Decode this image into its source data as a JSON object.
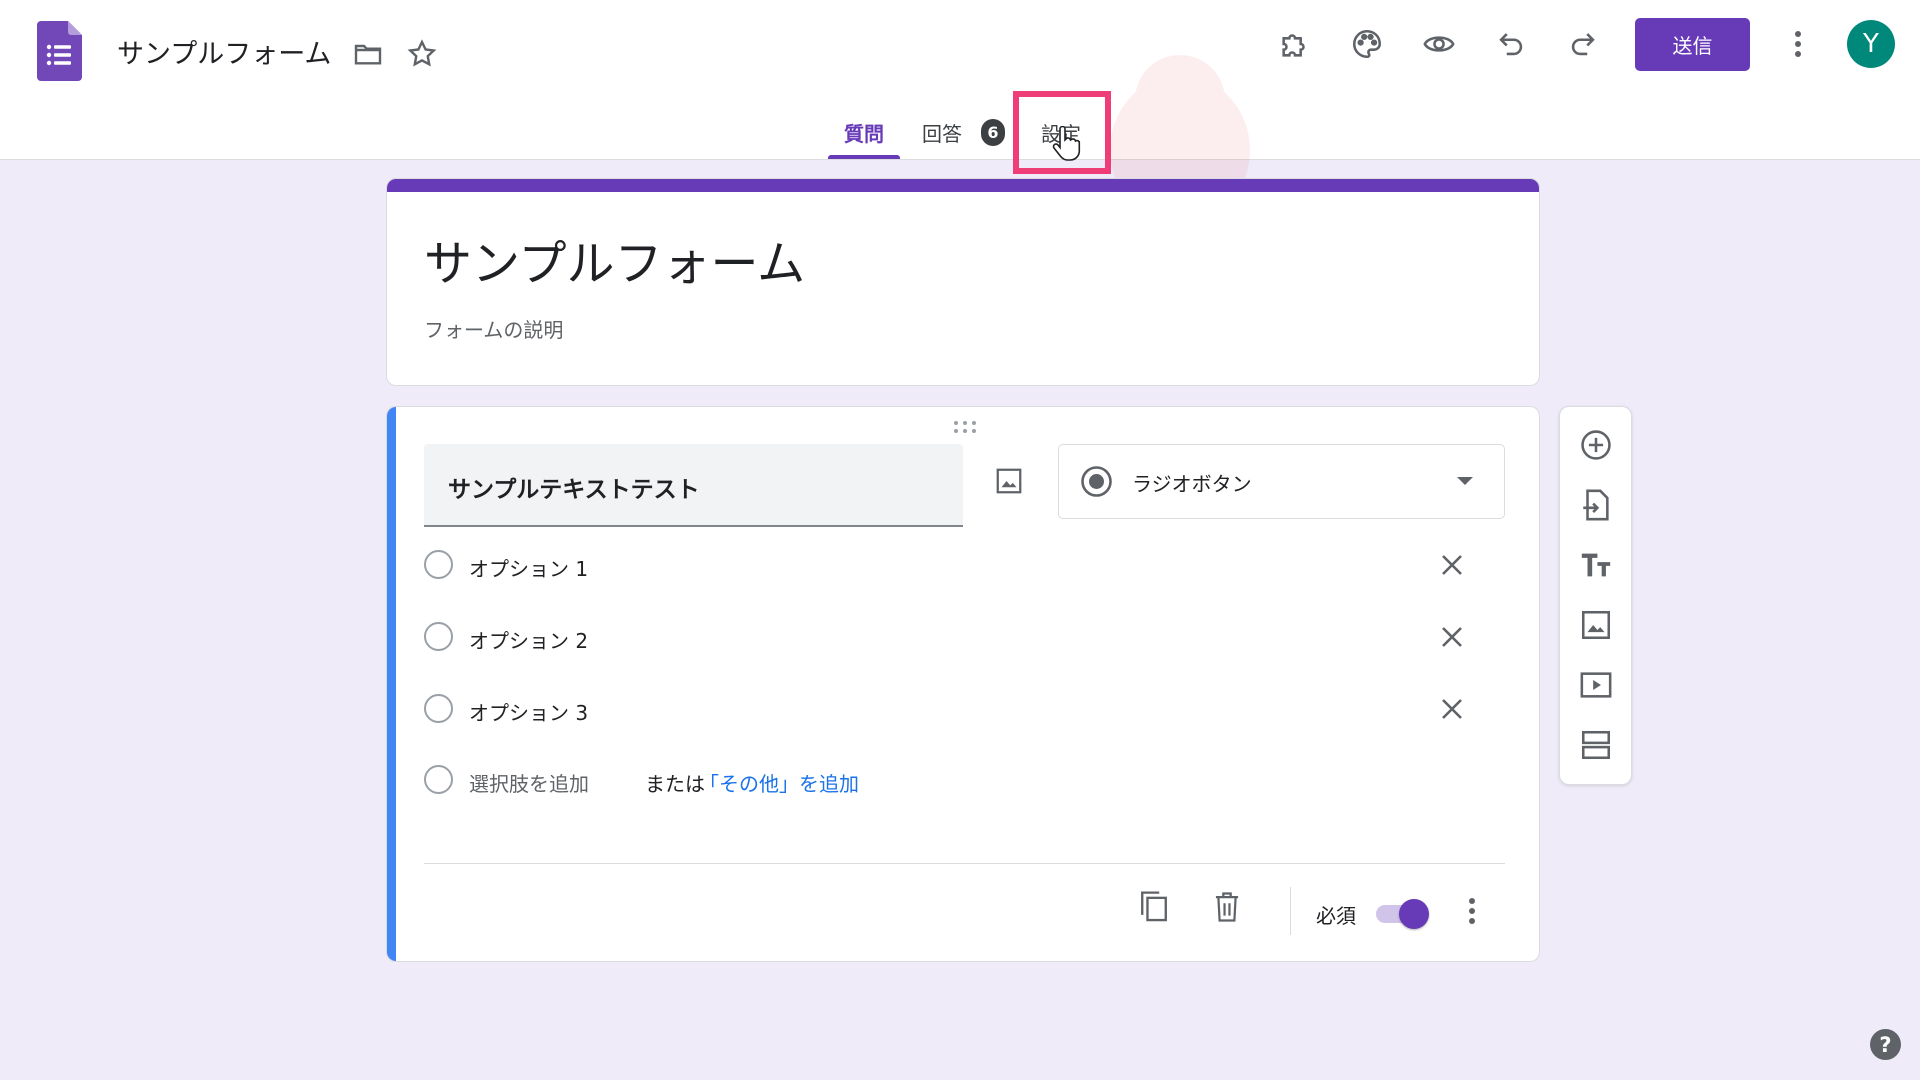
{
  "header": {
    "doc_title": "サンプルフォーム",
    "send_label": "送信",
    "avatar_initial": "Y",
    "icons": [
      "forms-logo-icon",
      "folder-icon",
      "star-icon",
      "addon-puzzle-icon",
      "palette-icon",
      "preview-eye-icon",
      "undo-icon",
      "redo-icon",
      "more-vert-icon"
    ]
  },
  "tabs": {
    "questions": "質問",
    "responses": "回答",
    "responses_count": "6",
    "settings": "設定",
    "active": "questions"
  },
  "form": {
    "title": "サンプルフォーム",
    "description_placeholder": "フォームの説明"
  },
  "question": {
    "title": "サンプルテキストテスト",
    "type": "ラジオボタン",
    "options": [
      {
        "label": "オプション 1"
      },
      {
        "label": "オプション 2"
      },
      {
        "label": "オプション 3"
      }
    ],
    "add_option": "選択肢を追加",
    "or_text": "または",
    "add_other": "「その他」を追加",
    "required_label": "必須",
    "required": true
  },
  "side_toolbar": [
    "add-question-icon",
    "import-questions-icon",
    "add-title-icon",
    "add-image-icon",
    "add-video-icon",
    "add-section-icon"
  ],
  "colors": {
    "accent": "#673ab7",
    "background": "#efebf8",
    "question_bar": "#4285f4",
    "highlight": "#ee3d77",
    "link": "#1a73e8",
    "avatar": "#00897b"
  },
  "help": "?"
}
